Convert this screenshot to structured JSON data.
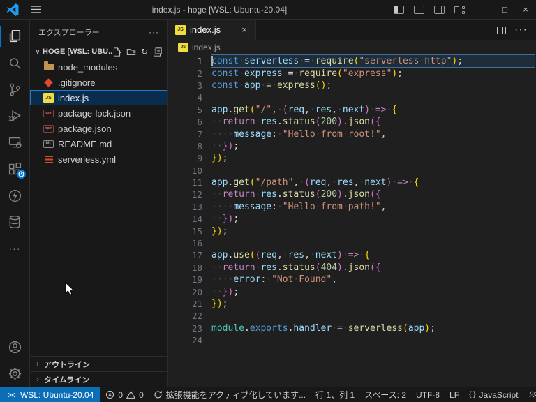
{
  "window": {
    "title": "index.js - hoge [WSL: Ubuntu-20.04]"
  },
  "glyphs": {
    "more": "···",
    "refresh": "↻",
    "chevron_down": "∨",
    "chevron_right": "›",
    "minimize": "–",
    "maximize": "□",
    "close": "×",
    "tab_close": "×",
    "braces": "{ }",
    "js_badge": "JS",
    "npm_badge": "npm",
    "md_badge": "M↓"
  },
  "activity_bar": {
    "items": [
      "explorer",
      "search",
      "source-control",
      "run-and-debug",
      "remote-explorer",
      "extensions",
      "thunder-client",
      "database",
      "more"
    ],
    "bottom_items": [
      "account",
      "settings"
    ],
    "active_item": "explorer",
    "extensions_badge": "activating-clock"
  },
  "sidebar": {
    "title": "エクスプローラー",
    "section_label": "HOGE [WSL: UBU...",
    "files": [
      {
        "label": "node_modules",
        "icon": "folder"
      },
      {
        "label": ".gitignore",
        "icon": "git"
      },
      {
        "label": "index.js",
        "icon": "js",
        "selected": true
      },
      {
        "label": "package-lock.json",
        "icon": "npm"
      },
      {
        "label": "package.json",
        "icon": "npm"
      },
      {
        "label": "README.md",
        "icon": "md"
      },
      {
        "label": "serverless.yml",
        "icon": "yml"
      }
    ],
    "panels": [
      "アウトライン",
      "タイムライン"
    ]
  },
  "editor": {
    "tab": {
      "label": "index.js"
    },
    "breadcrumb": {
      "file": "index.js"
    },
    "lines": [
      {
        "n": 1,
        "t": [
          [
            "const",
            "kw"
          ],
          [
            " ",
            "ws"
          ],
          [
            "serverless",
            "var"
          ],
          [
            " ",
            "ws"
          ],
          [
            "=",
            "pun"
          ],
          [
            " ",
            "ws"
          ],
          [
            "require",
            "fn"
          ],
          [
            "(",
            "b1"
          ],
          [
            "\"serverless-http\"",
            "str"
          ],
          [
            ")",
            "b1"
          ],
          [
            ";",
            "pun"
          ]
        ]
      },
      {
        "n": 2,
        "t": [
          [
            "const",
            "kw"
          ],
          [
            " ",
            "ws"
          ],
          [
            "express",
            "var"
          ],
          [
            " ",
            "ws"
          ],
          [
            "=",
            "pun"
          ],
          [
            " ",
            "ws"
          ],
          [
            "require",
            "fn"
          ],
          [
            "(",
            "b1"
          ],
          [
            "\"express\"",
            "str"
          ],
          [
            ")",
            "b1"
          ],
          [
            ";",
            "pun"
          ]
        ]
      },
      {
        "n": 3,
        "t": [
          [
            "const",
            "kw"
          ],
          [
            " ",
            "ws"
          ],
          [
            "app",
            "var"
          ],
          [
            " ",
            "ws"
          ],
          [
            "=",
            "pun"
          ],
          [
            " ",
            "ws"
          ],
          [
            "express",
            "fn"
          ],
          [
            "(",
            "b1"
          ],
          [
            ")",
            "b1"
          ],
          [
            ";",
            "pun"
          ]
        ]
      },
      {
        "n": 4,
        "t": []
      },
      {
        "n": 5,
        "t": [
          [
            "app",
            "var"
          ],
          [
            ".",
            "pun"
          ],
          [
            "get",
            "fn"
          ],
          [
            "(",
            "b1"
          ],
          [
            "\"/\"",
            "str"
          ],
          [
            ",",
            "pun"
          ],
          [
            " ",
            "ws"
          ],
          [
            "(",
            "b2"
          ],
          [
            "req",
            "var"
          ],
          [
            ",",
            "pun"
          ],
          [
            " ",
            "ws"
          ],
          [
            "res",
            "var"
          ],
          [
            ",",
            "pun"
          ],
          [
            " ",
            "ws"
          ],
          [
            "next",
            "var"
          ],
          [
            ")",
            "b2"
          ],
          [
            " ",
            "ws"
          ],
          [
            "=>",
            "ctrl"
          ],
          [
            " ",
            "ws"
          ],
          [
            "{",
            "b1"
          ]
        ]
      },
      {
        "n": 6,
        "g": [
          1
        ],
        "t": [
          [
            "  ",
            "ws"
          ],
          [
            "return",
            "ctrl"
          ],
          [
            " ",
            "ws"
          ],
          [
            "res",
            "var"
          ],
          [
            ".",
            "pun"
          ],
          [
            "status",
            "fn"
          ],
          [
            "(",
            "b2"
          ],
          [
            "200",
            "num"
          ],
          [
            ")",
            "b2"
          ],
          [
            ".",
            "pun"
          ],
          [
            "json",
            "fn"
          ],
          [
            "(",
            "b2"
          ],
          [
            "{",
            "b2"
          ]
        ]
      },
      {
        "n": 7,
        "g": [
          1,
          2
        ],
        "t": [
          [
            "    ",
            "ws"
          ],
          [
            "message",
            "var"
          ],
          [
            ":",
            "pun"
          ],
          [
            " ",
            "ws"
          ],
          [
            "\"Hello",
            "str"
          ],
          [
            " ",
            "ws"
          ],
          [
            "from",
            "str"
          ],
          [
            " ",
            "ws"
          ],
          [
            "root!\"",
            "str"
          ],
          [
            ",",
            "pun"
          ]
        ]
      },
      {
        "n": 8,
        "g": [
          1
        ],
        "t": [
          [
            "  ",
            "ws"
          ],
          [
            "}",
            "b2"
          ],
          [
            ")",
            "b2"
          ],
          [
            ";",
            "pun"
          ]
        ]
      },
      {
        "n": 9,
        "t": [
          [
            "}",
            "b1"
          ],
          [
            ")",
            "b1"
          ],
          [
            ";",
            "pun"
          ]
        ]
      },
      {
        "n": 10,
        "t": []
      },
      {
        "n": 11,
        "t": [
          [
            "app",
            "var"
          ],
          [
            ".",
            "pun"
          ],
          [
            "get",
            "fn"
          ],
          [
            "(",
            "b1"
          ],
          [
            "\"/path\"",
            "str"
          ],
          [
            ",",
            "pun"
          ],
          [
            " ",
            "ws"
          ],
          [
            "(",
            "b2"
          ],
          [
            "req",
            "var"
          ],
          [
            ",",
            "pun"
          ],
          [
            " ",
            "ws"
          ],
          [
            "res",
            "var"
          ],
          [
            ",",
            "pun"
          ],
          [
            " ",
            "ws"
          ],
          [
            "next",
            "var"
          ],
          [
            ")",
            "b2"
          ],
          [
            " ",
            "ws"
          ],
          [
            "=>",
            "ctrl"
          ],
          [
            " ",
            "ws"
          ],
          [
            "{",
            "b1"
          ]
        ]
      },
      {
        "n": 12,
        "g": [
          1
        ],
        "t": [
          [
            "  ",
            "ws"
          ],
          [
            "return",
            "ctrl"
          ],
          [
            " ",
            "ws"
          ],
          [
            "res",
            "var"
          ],
          [
            ".",
            "pun"
          ],
          [
            "status",
            "fn"
          ],
          [
            "(",
            "b2"
          ],
          [
            "200",
            "num"
          ],
          [
            ")",
            "b2"
          ],
          [
            ".",
            "pun"
          ],
          [
            "json",
            "fn"
          ],
          [
            "(",
            "b2"
          ],
          [
            "{",
            "b2"
          ]
        ]
      },
      {
        "n": 13,
        "g": [
          1,
          2
        ],
        "t": [
          [
            "    ",
            "ws"
          ],
          [
            "message",
            "var"
          ],
          [
            ":",
            "pun"
          ],
          [
            " ",
            "ws"
          ],
          [
            "\"Hello",
            "str"
          ],
          [
            " ",
            "ws"
          ],
          [
            "from",
            "str"
          ],
          [
            " ",
            "ws"
          ],
          [
            "path!\"",
            "str"
          ],
          [
            ",",
            "pun"
          ]
        ]
      },
      {
        "n": 14,
        "g": [
          1
        ],
        "t": [
          [
            "  ",
            "ws"
          ],
          [
            "}",
            "b2"
          ],
          [
            ")",
            "b2"
          ],
          [
            ";",
            "pun"
          ]
        ]
      },
      {
        "n": 15,
        "t": [
          [
            "}",
            "b1"
          ],
          [
            ")",
            "b1"
          ],
          [
            ";",
            "pun"
          ]
        ]
      },
      {
        "n": 16,
        "t": []
      },
      {
        "n": 17,
        "t": [
          [
            "app",
            "var"
          ],
          [
            ".",
            "pun"
          ],
          [
            "use",
            "fn"
          ],
          [
            "(",
            "b1"
          ],
          [
            "(",
            "b2"
          ],
          [
            "req",
            "var"
          ],
          [
            ",",
            "pun"
          ],
          [
            " ",
            "ws"
          ],
          [
            "res",
            "var"
          ],
          [
            ",",
            "pun"
          ],
          [
            " ",
            "ws"
          ],
          [
            "next",
            "var"
          ],
          [
            ")",
            "b2"
          ],
          [
            " ",
            "ws"
          ],
          [
            "=>",
            "ctrl"
          ],
          [
            " ",
            "ws"
          ],
          [
            "{",
            "b1"
          ]
        ]
      },
      {
        "n": 18,
        "g": [
          1
        ],
        "t": [
          [
            "  ",
            "ws"
          ],
          [
            "return",
            "ctrl"
          ],
          [
            " ",
            "ws"
          ],
          [
            "res",
            "var"
          ],
          [
            ".",
            "pun"
          ],
          [
            "status",
            "fn"
          ],
          [
            "(",
            "b2"
          ],
          [
            "404",
            "num"
          ],
          [
            ")",
            "b2"
          ],
          [
            ".",
            "pun"
          ],
          [
            "json",
            "fn"
          ],
          [
            "(",
            "b2"
          ],
          [
            "{",
            "b2"
          ]
        ]
      },
      {
        "n": 19,
        "g": [
          1,
          2
        ],
        "t": [
          [
            "    ",
            "ws"
          ],
          [
            "error",
            "var"
          ],
          [
            ":",
            "pun"
          ],
          [
            " ",
            "ws"
          ],
          [
            "\"Not",
            "str"
          ],
          [
            " ",
            "ws"
          ],
          [
            "Found\"",
            "str"
          ],
          [
            ",",
            "pun"
          ]
        ]
      },
      {
        "n": 20,
        "g": [
          1
        ],
        "t": [
          [
            "  ",
            "ws"
          ],
          [
            "}",
            "b2"
          ],
          [
            ")",
            "b2"
          ],
          [
            ";",
            "pun"
          ]
        ]
      },
      {
        "n": 21,
        "t": [
          [
            "}",
            "b1"
          ],
          [
            ")",
            "b1"
          ],
          [
            ";",
            "pun"
          ]
        ]
      },
      {
        "n": 22,
        "t": []
      },
      {
        "n": 23,
        "t": [
          [
            "module",
            "mod"
          ],
          [
            ".",
            "pun"
          ],
          [
            "exports",
            "kw"
          ],
          [
            ".",
            "pun"
          ],
          [
            "handler",
            "var"
          ],
          [
            " ",
            "ws"
          ],
          [
            "=",
            "pun"
          ],
          [
            " ",
            "ws"
          ],
          [
            "serverless",
            "fn"
          ],
          [
            "(",
            "b1"
          ],
          [
            "app",
            "var"
          ],
          [
            ")",
            "b1"
          ],
          [
            ";",
            "pun"
          ]
        ]
      },
      {
        "n": 24,
        "t": []
      }
    ]
  },
  "status_bar": {
    "remote": "WSL: Ubuntu-20.04",
    "errors": "0",
    "warnings": "0",
    "activity": "拡張機能をアクティブ化しています...",
    "cursor": "行 1、列 1",
    "indent": "スペース: 2",
    "encoding": "UTF-8",
    "eol": "LF",
    "language": "JavaScript"
  },
  "colors": {
    "accent": "#0078d4",
    "tab_active_border": "#6c9a3c",
    "remote_bg": "#0d6eb8",
    "selection_border": "#2b79c2"
  }
}
